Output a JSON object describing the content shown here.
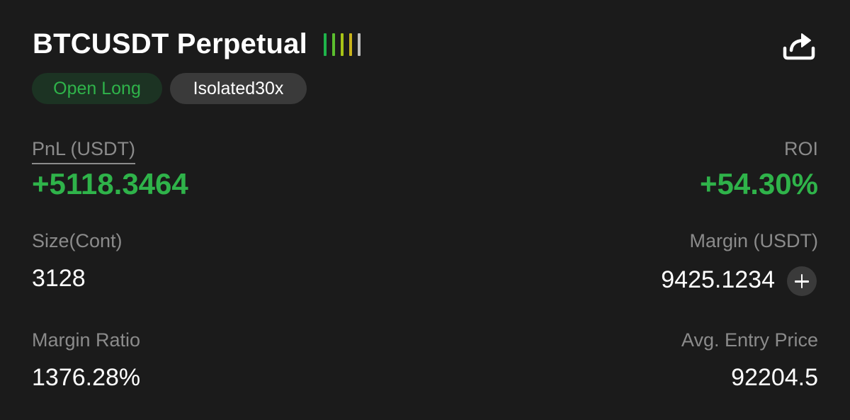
{
  "header": {
    "symbol": "BTCUSDT Perpetual",
    "risk_bar_colors": [
      "#1fb34a",
      "#5bbf2e",
      "#a8c416",
      "#c8b21a",
      "#bdbdbd"
    ],
    "share_icon": "share-icon"
  },
  "tags": {
    "side": "Open Long",
    "margin_mode": "Isolated30x"
  },
  "colors": {
    "profit": "#2fb34a",
    "background": "#1b1b1b",
    "label": "#8b8b8b"
  },
  "stats": {
    "pnl_label": "PnL (USDT)",
    "pnl_value": "+5118.3464",
    "roi_label": "ROI",
    "roi_value": "+54.30%",
    "size_label": "Size(Cont)",
    "size_value": "3128",
    "margin_label": "Margin (USDT)",
    "margin_value": "9425.1234",
    "margin_ratio_label": "Margin Ratio",
    "margin_ratio_value": "1376.28%",
    "entry_price_label": "Avg. Entry Price",
    "entry_price_value": "92204.5"
  }
}
